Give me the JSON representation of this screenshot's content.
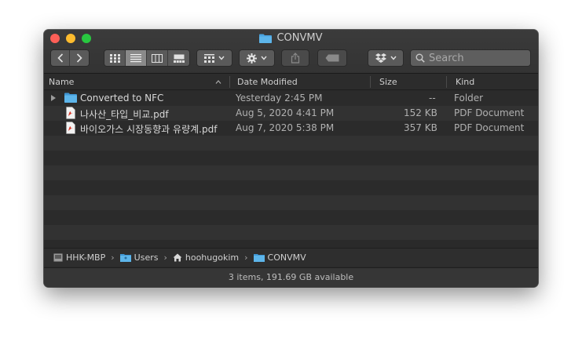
{
  "window": {
    "title": "CONVMV"
  },
  "toolbar": {
    "search_placeholder": "Search"
  },
  "columns": {
    "name": "Name",
    "date": "Date Modified",
    "size": "Size",
    "kind": "Kind"
  },
  "files": [
    {
      "name": "Converted to NFC",
      "date": "Yesterday 2:45 PM",
      "size": "--",
      "kind": "Folder",
      "type": "folder"
    },
    {
      "name": "나사산_타입_비교.pdf",
      "date": "Aug 5, 2020 4:41 PM",
      "size": "152 KB",
      "kind": "PDF Document",
      "type": "pdf"
    },
    {
      "name": "바이오가스 시장동향과 유량계.pdf",
      "date": "Aug 7, 2020 5:38 PM",
      "size": "357 KB",
      "kind": "PDF Document",
      "type": "pdf"
    }
  ],
  "path": {
    "items": [
      "HHK-MBP",
      "Users",
      "hoohugokim",
      "CONVMV"
    ]
  },
  "status": {
    "text": "3 items, 191.69 GB available"
  },
  "colors": {
    "folder_blue": "#4aa3df",
    "pdf_red": "#d93a2b"
  }
}
